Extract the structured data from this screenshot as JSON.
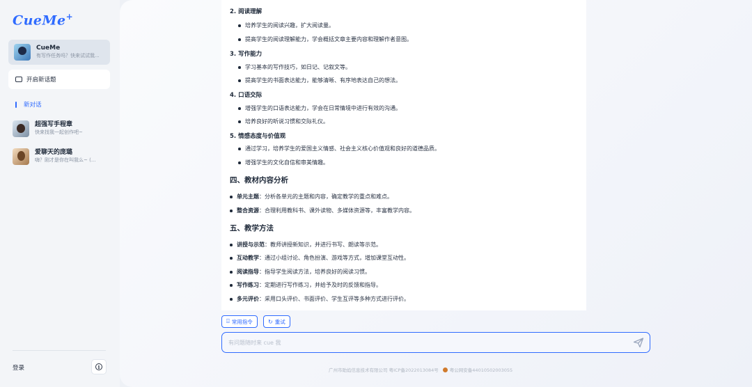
{
  "sidebar": {
    "logo": "CueMe",
    "logo_mark": "+",
    "bot": {
      "name": "CueMe",
      "subtitle": "有写作任务吗？快来试试我..."
    },
    "new_topic": "开启新话题",
    "new_chat": "新对话",
    "conversations": [
      {
        "title": "超强写手程章",
        "subtitle": "快来找我一起创作吧~"
      },
      {
        "title": "爱聊天的庞璐",
        "subtitle": "嗨？刚才是你在叫我么~ (..."
      }
    ],
    "login": "登录"
  },
  "doc": {
    "top_partial": "2. 阅读理解",
    "items": [
      {
        "kind": "bullet",
        "text": "培养学生的阅读兴趣，扩大阅读量。"
      },
      {
        "kind": "bullet",
        "text": "提高学生的阅读理解能力，学会概括文章主要内容和理解作者意图。"
      },
      {
        "kind": "num",
        "text": "3. 写作能力"
      },
      {
        "kind": "bullet",
        "text": "学习基本的写作技巧，如日记、记叙文等。"
      },
      {
        "kind": "bullet",
        "text": "提高学生的书面表达能力，能够清晰、有序地表达自己的想法。"
      },
      {
        "kind": "num",
        "text": "4. 口语交际"
      },
      {
        "kind": "bullet",
        "text": "增强学生的口语表达能力，学会在日常情境中进行有效的沟通。"
      },
      {
        "kind": "bullet",
        "text": "培养良好的听说习惯和交际礼仪。"
      },
      {
        "kind": "num",
        "text": "5. 情感态度与价值观"
      },
      {
        "kind": "bullet",
        "text": "通过学习，培养学生的爱国主义情感、社会主义核心价值观和良好的道德品质。"
      },
      {
        "kind": "bullet",
        "text": "增强学生的文化自信和审美情趣。"
      }
    ],
    "section4": {
      "heading": "四、教材内容分析",
      "items": [
        {
          "label": "单元主题",
          "text": "：分析各单元的主题和内容，确定教学的重点和难点。"
        },
        {
          "label": "整合资源",
          "text": "：合理利用教科书、课外读物、多媒体资源等，丰富教学内容。"
        }
      ]
    },
    "section5": {
      "heading": "五、教学方法",
      "items": [
        {
          "label": "讲授与示范",
          "text": "：教师讲授新知识，并进行书写、朗读等示范。"
        },
        {
          "label": "互动教学",
          "text": "：通过小组讨论、角色扮演、游戏等方式，增加课堂互动性。"
        },
        {
          "label": "阅读指导",
          "text": "：指导学生阅读方法，培养良好的阅读习惯。"
        },
        {
          "label": "写作练习",
          "text": "：定期进行写作练习，并给予及时的反馈和指导。"
        },
        {
          "label": "多元评价",
          "text": "：采用口头评价、书面评价、学生互评等多种方式进行评价。"
        }
      ]
    }
  },
  "actions": {
    "common": "常用指令",
    "retry": "重试"
  },
  "input": {
    "placeholder": "有问题随时来 cue 我"
  },
  "footer": {
    "company": "广州市助焰信息技术有限公司 粤ICP备2022013084号",
    "police": "粤公网安备44010502003055"
  }
}
